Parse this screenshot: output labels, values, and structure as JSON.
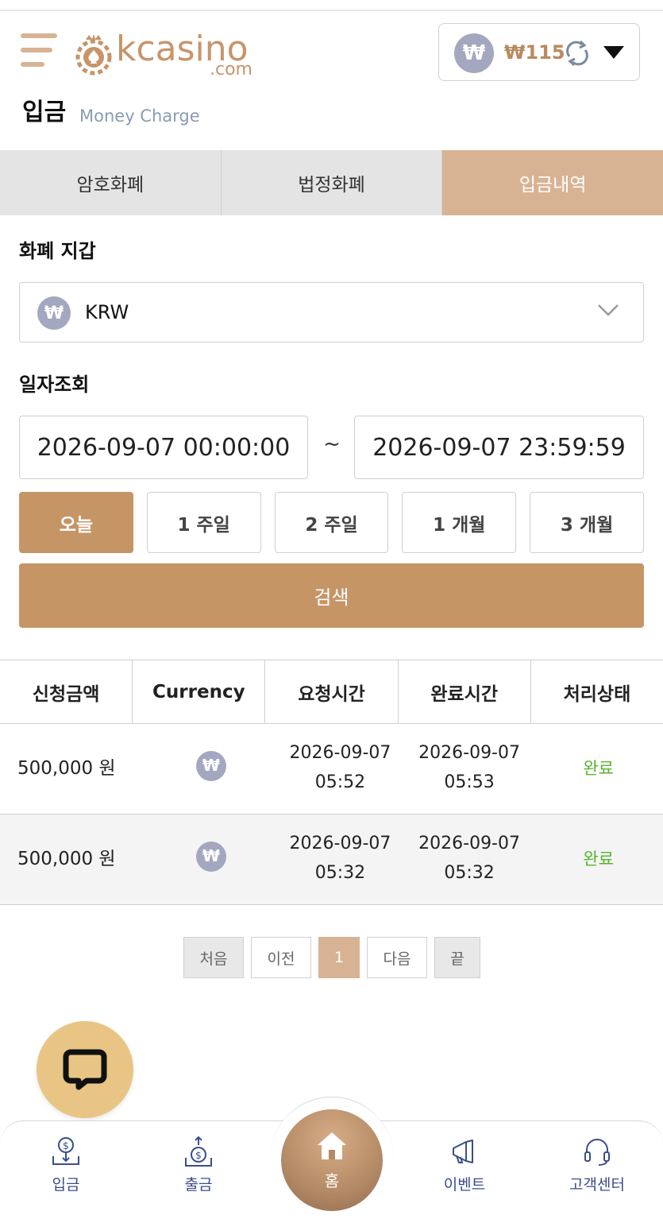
{
  "header": {
    "logo_word": "kcasino",
    "logo_domain": ".com",
    "balance_currency_symbol": "₩",
    "balance_text": "₩115"
  },
  "page": {
    "title": "입금",
    "subtitle": "Money Charge"
  },
  "tabs": [
    {
      "label": "암호화폐",
      "active": false
    },
    {
      "label": "법정화폐",
      "active": false
    },
    {
      "label": "입금내역",
      "active": true
    }
  ],
  "wallet": {
    "label": "화폐 지갑",
    "currency_symbol": "₩",
    "selected": "KRW"
  },
  "date_filter": {
    "label": "일자조회",
    "start": "2026-09-07 00:00:00",
    "separator": "~",
    "end": "2026-09-07 23:59:59",
    "periods": [
      "오늘",
      "1 주일",
      "2 주일",
      "1 개월",
      "3 개월"
    ],
    "active_period": "오늘",
    "search_label": "검색"
  },
  "table": {
    "headers": [
      "신청금액",
      "Currency",
      "요청시간",
      "완료시간",
      "처리상태"
    ],
    "rows": [
      {
        "amount": "500,000 원",
        "currency_symbol": "₩",
        "request_date": "2026-09-07",
        "request_time": "05:52",
        "complete_date": "2026-09-07",
        "complete_time": "05:53",
        "status": "완료"
      },
      {
        "amount": "500,000 원",
        "currency_symbol": "₩",
        "request_date": "2026-09-07",
        "request_time": "05:32",
        "complete_date": "2026-09-07",
        "complete_time": "05:32",
        "status": "완료"
      }
    ]
  },
  "pagination": {
    "first": "처음",
    "prev": "이전",
    "current": "1",
    "next": "다음",
    "last": "끝"
  },
  "bottom_nav": {
    "deposit": "입금",
    "withdraw": "출금",
    "home": "홈",
    "event": "이벤트",
    "support": "고객센터"
  },
  "colors": {
    "accent": "#c69566",
    "tab_active": "#d8b393",
    "status_complete": "#55b52b",
    "coin": "#a3a7c0",
    "chat_fab": "#e8c584",
    "nav_text": "#3a4e8a"
  },
  "icons": {
    "menu": "hamburger-icon",
    "refresh": "refresh-icon",
    "caret": "caret-down-icon",
    "chevron": "chevron-down-icon",
    "chat": "chat-bubble-icon",
    "deposit": "deposit-icon",
    "withdraw": "withdraw-icon",
    "home": "home-icon",
    "event": "megaphone-icon",
    "support": "headset-icon"
  }
}
